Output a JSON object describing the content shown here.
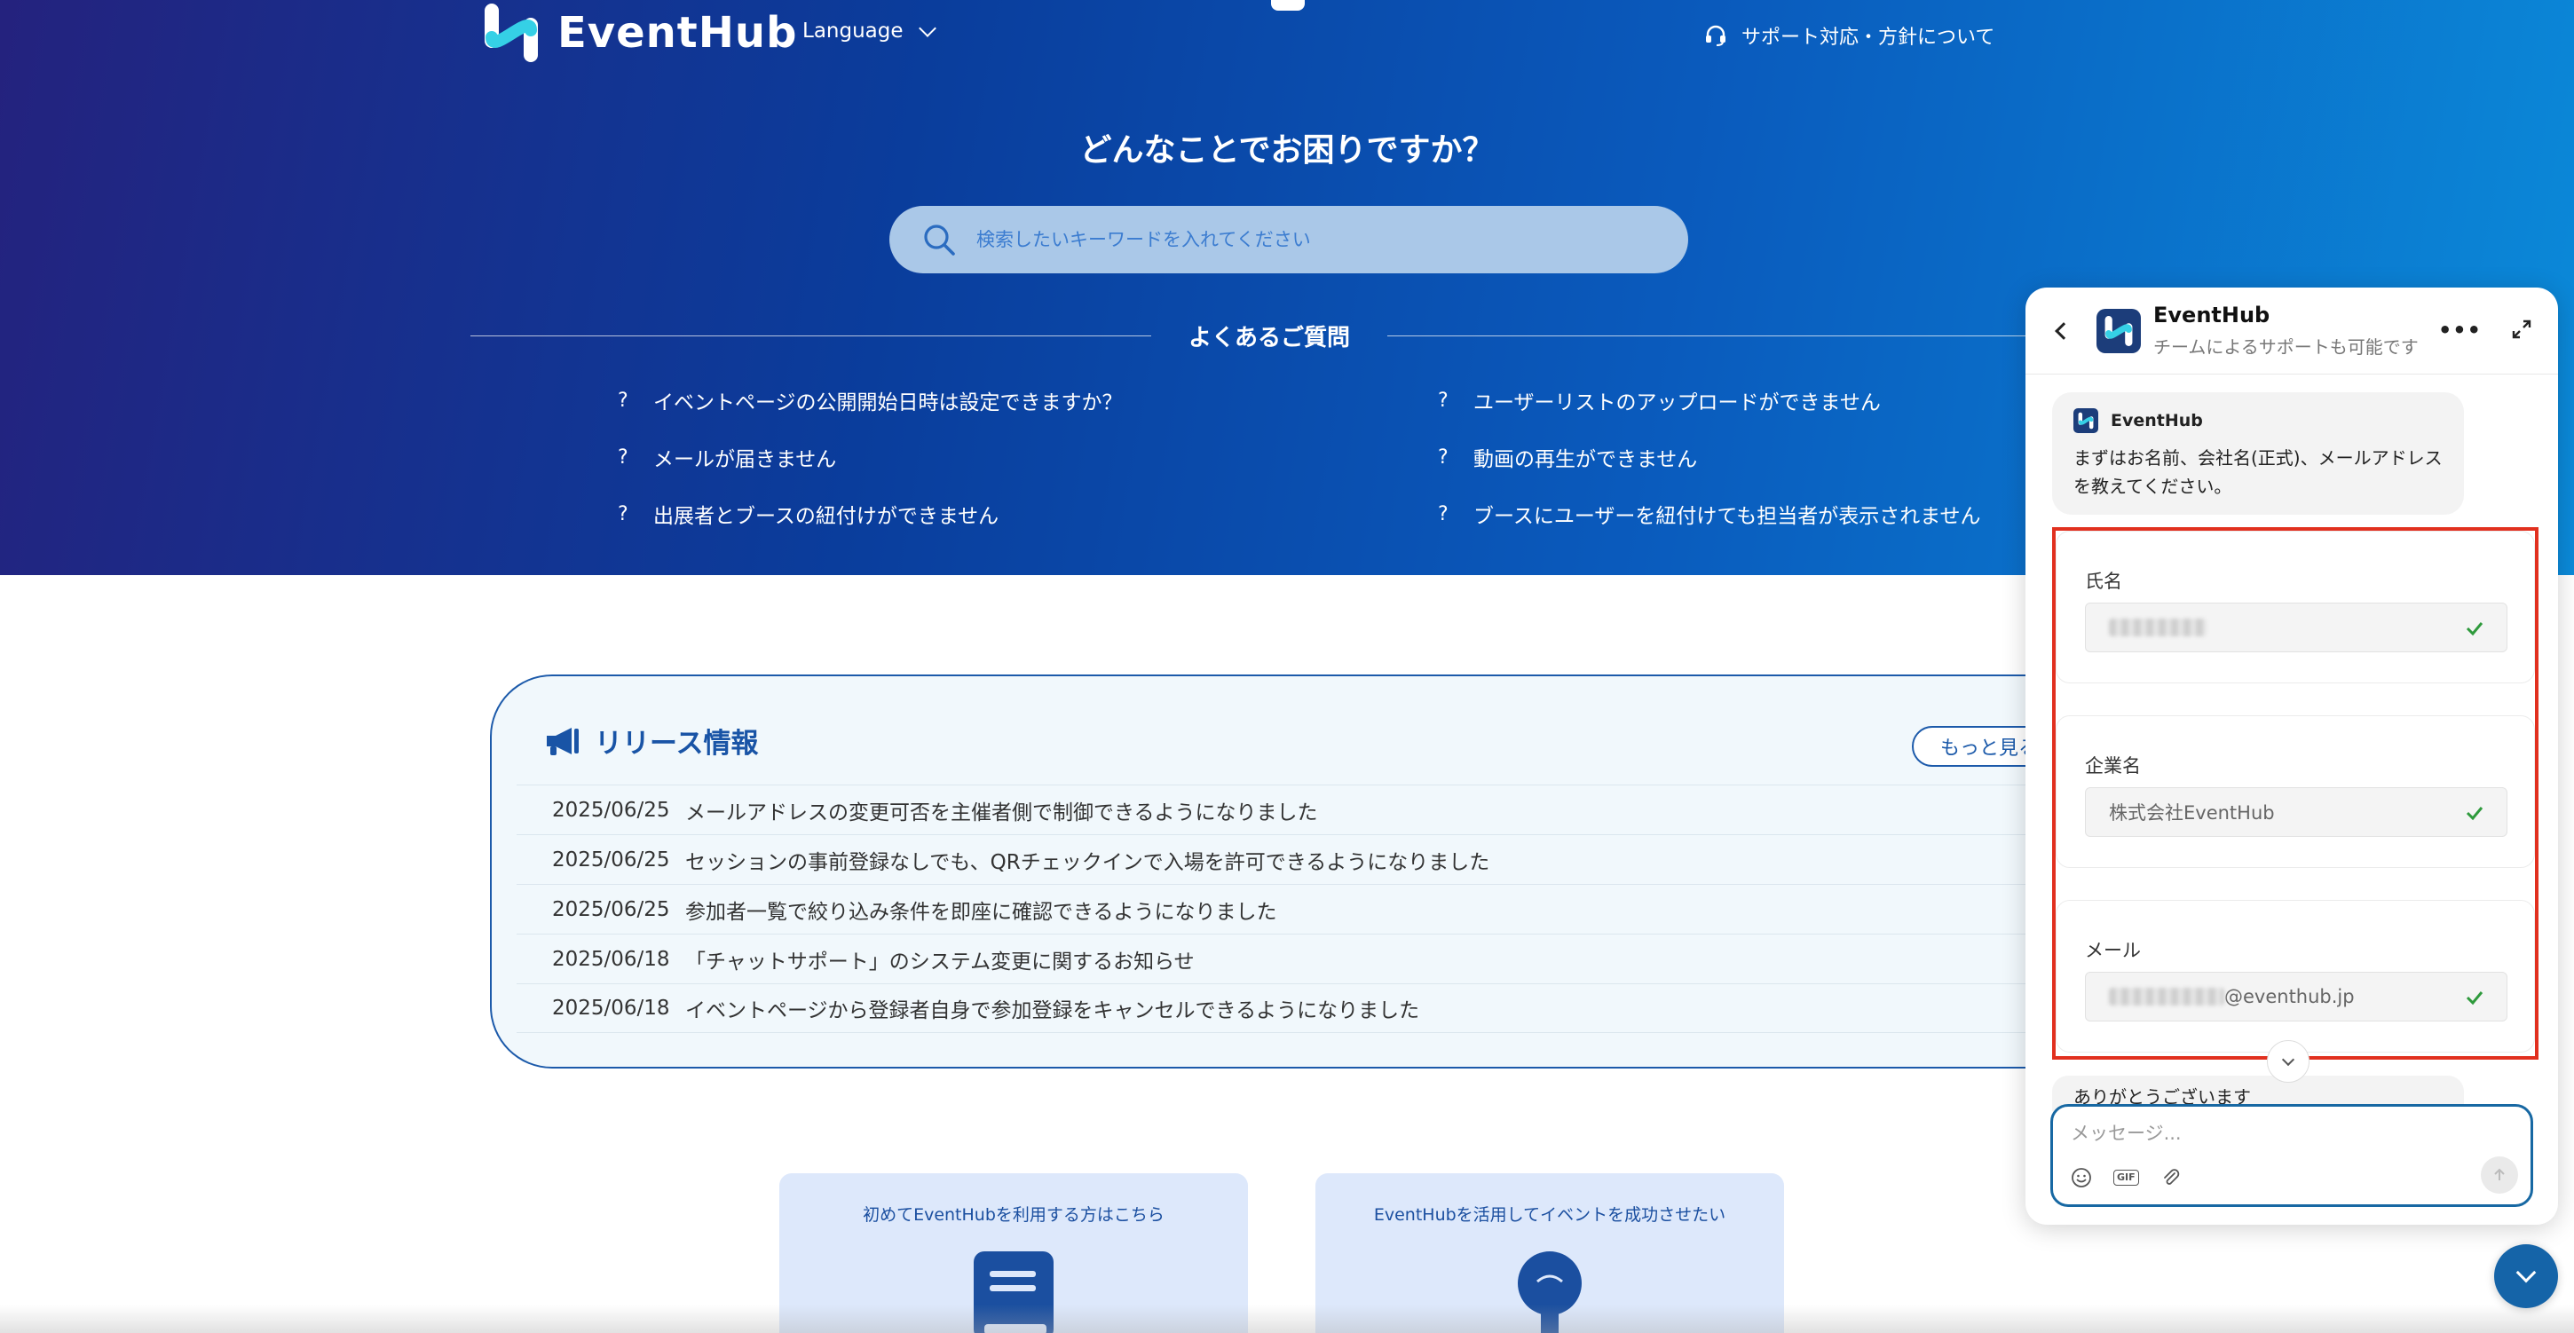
{
  "header": {
    "logo_text": "EventHub",
    "language_label": "Language",
    "support_link": "サポート対応・方針について"
  },
  "hero": {
    "title": "どんなことでお困りですか？",
    "search_placeholder": "検索したいキーワードを入れてください"
  },
  "faq": {
    "heading": "よくあるご質問",
    "items": [
      "イベントページの公開開始日時は設定できますか？",
      "ユーザーリストのアップロードができません",
      "メールが届きません",
      "動画の再生ができません",
      "出展者とブースの紐付けができません",
      "ブースにユーザーを紐付けても担当者が表示されません"
    ]
  },
  "release": {
    "title": "リリース情報",
    "more_label": "もっと見る",
    "rows": [
      {
        "date": "2025/06/25",
        "text": "メールアドレスの変更可否を主催者側で制御できるようになりました"
      },
      {
        "date": "2025/06/25",
        "text": "セッションの事前登録なしでも、QRチェックインで入場を許可できるようになりました"
      },
      {
        "date": "2025/06/25",
        "text": "参加者一覧で絞り込み条件を即座に確認できるようになりました"
      },
      {
        "date": "2025/06/18",
        "text": "「チャットサポート」のシステム変更に関するお知らせ"
      },
      {
        "date": "2025/06/18",
        "text": "イベントページから登録者自身で参加登録をキャンセルできるようになりました"
      }
    ]
  },
  "cards": [
    {
      "title": "初めてEventHubを利用する方はこちら",
      "icon": "book-icon"
    },
    {
      "title": "EventHubを活用してイベントを成功させたい",
      "icon": "lightbulb-icon"
    }
  ],
  "chat": {
    "name": "EventHub",
    "subtitle": "チームによるサポートも可能です",
    "bubble_sender": "EventHub",
    "bubble_text": "まずはお名前、会社名(正式)、メールアドレスを教えてください。",
    "fields": [
      {
        "label": "氏名",
        "value": ""
      },
      {
        "label": "企業名",
        "value": "株式会社EventHub"
      },
      {
        "label": "メール",
        "value": "@eventhub.jp"
      }
    ],
    "partial_message": "ありがとうございます",
    "composer_placeholder": "メッセージ...",
    "gif_label": "GIF"
  },
  "colors": {
    "hero_start": "#24227e",
    "hero_end": "#0b8ad9",
    "accent": "#1c5aaa",
    "highlight_border": "#e1301f",
    "check": "#2e9a3c"
  }
}
